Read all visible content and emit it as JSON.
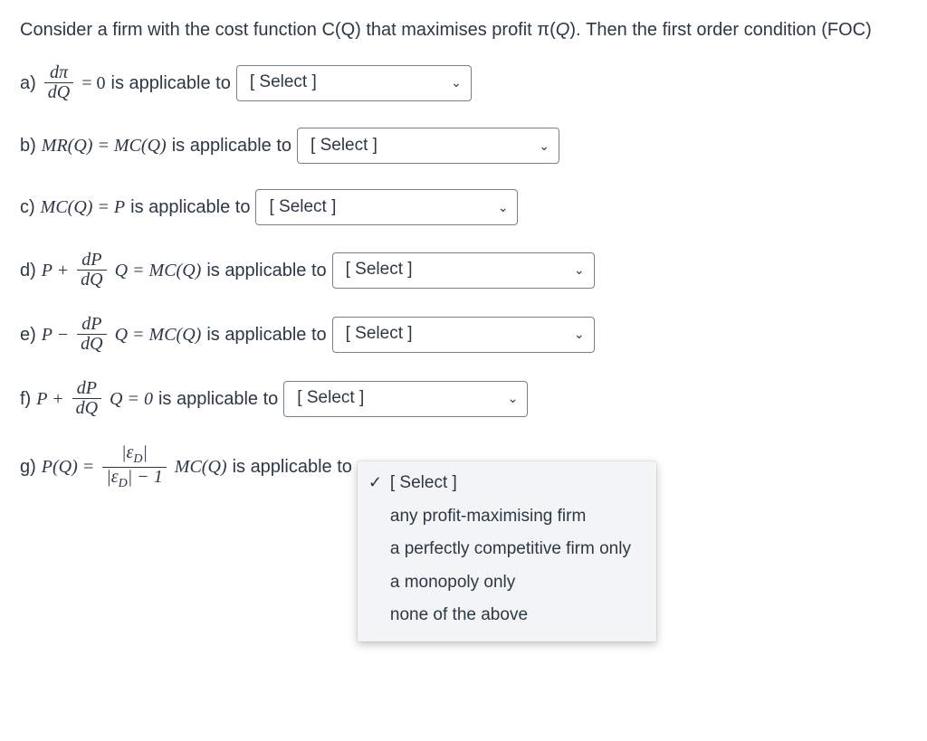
{
  "intro_html": "Consider a firm with the cost function C(Q) that maximises profit π(<i>Q</i>). Then the first order condition (FOC)",
  "applicable_text": "is applicable to",
  "select_placeholder": "[ Select ]",
  "items": {
    "a": {
      "letter": "a)",
      "lhs_num": "dπ",
      "lhs_den": "dQ",
      "eq": "= 0"
    },
    "b": {
      "letter": "b)",
      "expr": "MR(Q) = MC(Q)"
    },
    "c": {
      "letter": "c)",
      "expr": "MC(Q) = P"
    },
    "d": {
      "letter": "d)",
      "pre": "P +",
      "num": "dP",
      "den": "dQ",
      "post": "Q = MC(Q)"
    },
    "e": {
      "letter": "e)",
      "pre": "P −",
      "num": "dP",
      "den": "dQ",
      "post": "Q = MC(Q)"
    },
    "f": {
      "letter": "f)",
      "pre": "P +",
      "num": "dP",
      "den": "dQ",
      "post": "Q = 0"
    },
    "g": {
      "letter": "g)",
      "pre": "P(Q) =",
      "num": "|εD|",
      "den": "|εD| − 1",
      "post": "MC(Q)",
      "trail": "is applicable to"
    }
  },
  "menu": {
    "selected": "[ Select ]",
    "options": [
      "any profit-maximising firm",
      "a perfectly competitive firm only",
      "a monopoly only",
      "none of the above"
    ]
  }
}
